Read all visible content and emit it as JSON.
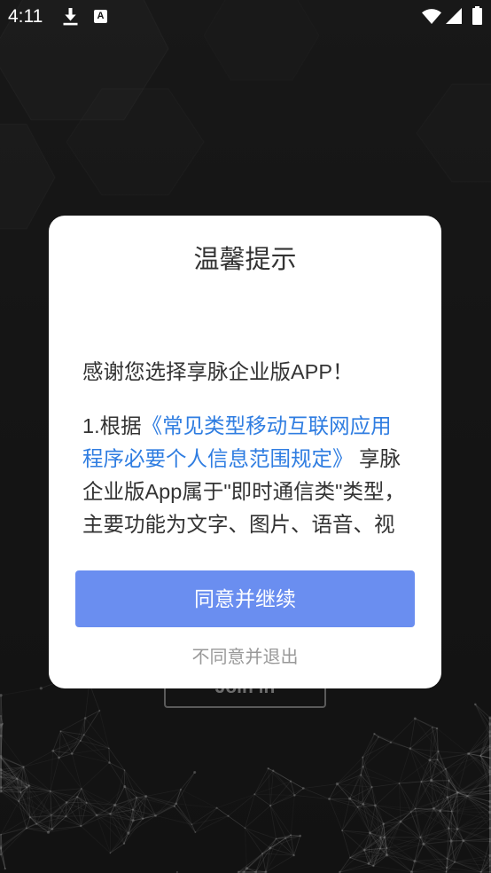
{
  "status_bar": {
    "time": "4:11",
    "notification_icons": [
      "download-icon",
      "app-notification-icon"
    ],
    "notification_icon_letter": "A",
    "system_icons": [
      "wifi-icon",
      "cellular-signal-icon",
      "battery-icon"
    ]
  },
  "background_screen": {
    "join_button_label": "Join in"
  },
  "dialog": {
    "title": "温馨提示",
    "greeting": "感谢您选择享脉企业版APP！",
    "policy_paragraph": {
      "prefix": "1.根据",
      "link": "《常见类型移动互联网应用程序必要个人信息范围规定》",
      "suffix": " 享脉企业版App属于\"即时通信类\"类型，主要功能为文字、图片、语音、视"
    },
    "agree_button_label": "同意并继续",
    "disagree_label": "不同意并退出"
  },
  "colors": {
    "dialog_background": "#ffffff",
    "body_text": "#333333",
    "link": "#2f7de1",
    "agree_button": "#6a8ef0",
    "agree_button_text": "#ffffff",
    "secondary_text": "#999999"
  }
}
